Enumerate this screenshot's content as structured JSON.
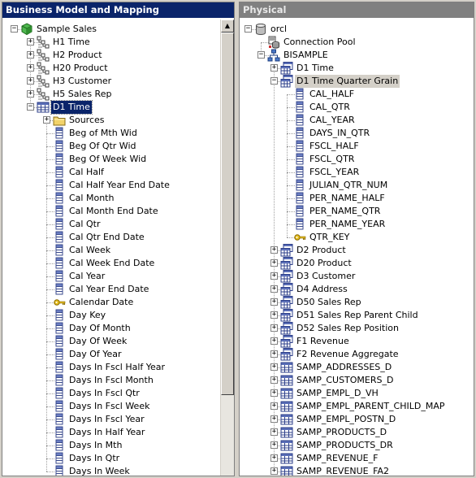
{
  "left_panel": {
    "title": "Business Model and Mapping",
    "tree": [
      {
        "level": 0,
        "label": "Sample Sales",
        "icon": "business-model-icon",
        "expander": "-"
      },
      {
        "level": 1,
        "label": "H1 Time",
        "icon": "hierarchy-icon",
        "expander": "+"
      },
      {
        "level": 1,
        "label": "H2 Product",
        "icon": "hierarchy-icon",
        "expander": "+"
      },
      {
        "level": 1,
        "label": "H20 Product",
        "icon": "hierarchy-icon",
        "expander": "+"
      },
      {
        "level": 1,
        "label": "H3 Customer",
        "icon": "hierarchy-icon",
        "expander": "+"
      },
      {
        "level": 1,
        "label": "H5 Sales Rep",
        "icon": "hierarchy-icon",
        "expander": "+"
      },
      {
        "level": 1,
        "label": "D1 Time",
        "icon": "table-icon",
        "expander": "-",
        "selected": true
      },
      {
        "level": 2,
        "label": "Sources",
        "icon": "folder-icon",
        "expander": "+"
      },
      {
        "level": 2,
        "label": "Beg of Mth Wid",
        "icon": "column-icon"
      },
      {
        "level": 2,
        "label": "Beg Of Qtr Wid",
        "icon": "column-icon"
      },
      {
        "level": 2,
        "label": "Beg Of Week Wid",
        "icon": "column-icon"
      },
      {
        "level": 2,
        "label": "Cal Half",
        "icon": "column-icon"
      },
      {
        "level": 2,
        "label": "Cal Half Year End Date",
        "icon": "column-icon"
      },
      {
        "level": 2,
        "label": "Cal Month",
        "icon": "column-icon"
      },
      {
        "level": 2,
        "label": "Cal Month End Date",
        "icon": "column-icon"
      },
      {
        "level": 2,
        "label": "Cal Qtr",
        "icon": "column-icon"
      },
      {
        "level": 2,
        "label": "Cal Qtr End Date",
        "icon": "column-icon"
      },
      {
        "level": 2,
        "label": "Cal Week",
        "icon": "column-icon"
      },
      {
        "level": 2,
        "label": "Cal Week End Date",
        "icon": "column-icon"
      },
      {
        "level": 2,
        "label": "Cal Year",
        "icon": "column-icon"
      },
      {
        "level": 2,
        "label": "Cal Year End Date",
        "icon": "column-icon"
      },
      {
        "level": 2,
        "label": "Calendar Date",
        "icon": "key-icon"
      },
      {
        "level": 2,
        "label": "Day Key",
        "icon": "column-icon"
      },
      {
        "level": 2,
        "label": "Day Of Month",
        "icon": "column-icon"
      },
      {
        "level": 2,
        "label": "Day Of Week",
        "icon": "column-icon"
      },
      {
        "level": 2,
        "label": "Day Of Year",
        "icon": "column-icon"
      },
      {
        "level": 2,
        "label": "Days In Fscl Half Year",
        "icon": "column-icon"
      },
      {
        "level": 2,
        "label": "Days In Fscl Month",
        "icon": "column-icon"
      },
      {
        "level": 2,
        "label": "Days In Fscl Qtr",
        "icon": "column-icon"
      },
      {
        "level": 2,
        "label": "Days In Fscl Week",
        "icon": "column-icon"
      },
      {
        "level": 2,
        "label": "Days In Fscl Year",
        "icon": "column-icon"
      },
      {
        "level": 2,
        "label": "Days In Half Year",
        "icon": "column-icon"
      },
      {
        "level": 2,
        "label": "Days In Mth",
        "icon": "column-icon"
      },
      {
        "level": 2,
        "label": "Days In Qtr",
        "icon": "column-icon"
      },
      {
        "level": 2,
        "label": "Days In Week",
        "icon": "column-icon"
      }
    ]
  },
  "right_panel": {
    "title": "Physical",
    "tree": [
      {
        "level": 0,
        "label": "orcl",
        "icon": "database-icon",
        "expander": "-"
      },
      {
        "level": 1,
        "label": "Connection Pool",
        "icon": "connection-pool-icon"
      },
      {
        "level": 1,
        "label": "BISAMPLE",
        "icon": "schema-icon",
        "expander": "-"
      },
      {
        "level": 2,
        "label": "D1 Time",
        "icon": "alias-table-icon",
        "expander": "+"
      },
      {
        "level": 2,
        "label": "D1 Time Quarter Grain",
        "icon": "alias-table-icon",
        "expander": "-",
        "highlighted": true
      },
      {
        "level": 3,
        "label": "CAL_HALF",
        "icon": "column-icon"
      },
      {
        "level": 3,
        "label": "CAL_QTR",
        "icon": "column-icon"
      },
      {
        "level": 3,
        "label": "CAL_YEAR",
        "icon": "column-icon"
      },
      {
        "level": 3,
        "label": "DAYS_IN_QTR",
        "icon": "column-icon"
      },
      {
        "level": 3,
        "label": "FSCL_HALF",
        "icon": "column-icon"
      },
      {
        "level": 3,
        "label": "FSCL_QTR",
        "icon": "column-icon"
      },
      {
        "level": 3,
        "label": "FSCL_YEAR",
        "icon": "column-icon"
      },
      {
        "level": 3,
        "label": "JULIAN_QTR_NUM",
        "icon": "column-icon"
      },
      {
        "level": 3,
        "label": "PER_NAME_HALF",
        "icon": "column-icon"
      },
      {
        "level": 3,
        "label": "PER_NAME_QTR",
        "icon": "column-icon"
      },
      {
        "level": 3,
        "label": "PER_NAME_YEAR",
        "icon": "column-icon"
      },
      {
        "level": 3,
        "label": "QTR_KEY",
        "icon": "key-icon"
      },
      {
        "level": 2,
        "label": "D2 Product",
        "icon": "alias-table-icon",
        "expander": "+"
      },
      {
        "level": 2,
        "label": "D20 Product",
        "icon": "alias-table-icon",
        "expander": "+"
      },
      {
        "level": 2,
        "label": "D3 Customer",
        "icon": "alias-table-icon",
        "expander": "+"
      },
      {
        "level": 2,
        "label": "D4 Address",
        "icon": "alias-table-icon",
        "expander": "+"
      },
      {
        "level": 2,
        "label": "D50 Sales Rep",
        "icon": "alias-table-icon",
        "expander": "+"
      },
      {
        "level": 2,
        "label": "D51 Sales Rep Parent Child",
        "icon": "alias-table-icon",
        "expander": "+"
      },
      {
        "level": 2,
        "label": "D52 Sales Rep Position",
        "icon": "alias-table-icon",
        "expander": "+"
      },
      {
        "level": 2,
        "label": "F1 Revenue",
        "icon": "alias-table-icon",
        "expander": "+"
      },
      {
        "level": 2,
        "label": "F2 Revenue Aggregate",
        "icon": "alias-table-icon",
        "expander": "+"
      },
      {
        "level": 2,
        "label": "SAMP_ADDRESSES_D",
        "icon": "table-icon",
        "expander": "+"
      },
      {
        "level": 2,
        "label": "SAMP_CUSTOMERS_D",
        "icon": "table-icon",
        "expander": "+"
      },
      {
        "level": 2,
        "label": "SAMP_EMPL_D_VH",
        "icon": "table-icon",
        "expander": "+"
      },
      {
        "level": 2,
        "label": "SAMP_EMPL_PARENT_CHILD_MAP",
        "icon": "table-icon",
        "expander": "+"
      },
      {
        "level": 2,
        "label": "SAMP_EMPL_POSTN_D",
        "icon": "table-icon",
        "expander": "+"
      },
      {
        "level": 2,
        "label": "SAMP_PRODUCTS_D",
        "icon": "table-icon",
        "expander": "+"
      },
      {
        "level": 2,
        "label": "SAMP_PRODUCTS_DR",
        "icon": "table-icon",
        "expander": "+"
      },
      {
        "level": 2,
        "label": "SAMP_REVENUE_F",
        "icon": "table-icon",
        "expander": "+"
      },
      {
        "level": 2,
        "label": "SAMP_REVENUE_FA2",
        "icon": "table-icon",
        "expander": "+"
      }
    ]
  },
  "colors": {
    "active_title": "#0a246a",
    "inactive_title": "#808080",
    "selection": "#0a246a",
    "window_bg": "#d4d0c8"
  }
}
